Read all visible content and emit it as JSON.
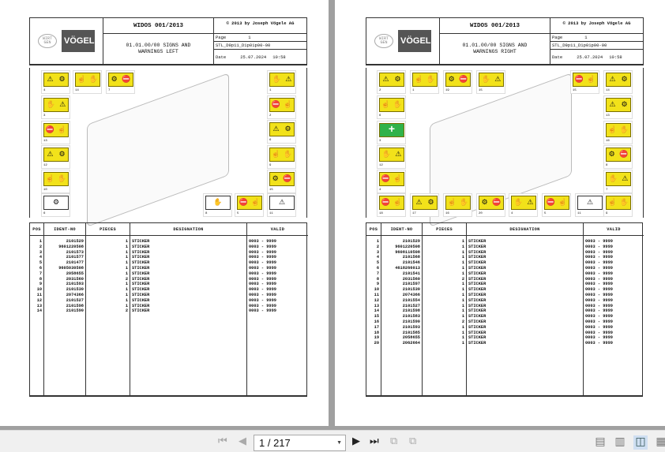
{
  "pages": [
    {
      "doc": "WIDOS 001/2013",
      "copyright": "© 2013 by Joseph Vögele AG",
      "subtitle": "01.01.00/00 SIGNS AND\nWARNINGS LEFT",
      "page_label": "Page",
      "page_num": "1",
      "code": "STL_D9p11_D1p01p00-00",
      "date_label": "Date",
      "date": "25.07.2024",
      "time": "10:58",
      "logo_wirtgen": "WIRTGEN GROUP",
      "logo_vogele": "VÖGELE",
      "stickers": [
        "4",
        "14",
        "7",
        "3",
        "13",
        "12",
        "10",
        "6",
        "1",
        "2",
        "6",
        "9",
        "15",
        "8",
        "5",
        "11"
      ],
      "headers": [
        "POS",
        "IDENT-NO",
        "PIECES",
        "DESIGNATION",
        "VALID"
      ],
      "rows": [
        [
          "1",
          "2101529",
          "1",
          "STICKER",
          "0003 - 9999"
        ],
        [
          "2",
          "9601220508",
          "1",
          "STICKER",
          "0003 - 9999"
        ],
        [
          "3",
          "2101573",
          "1",
          "STICKER",
          "0003 - 9999"
        ],
        [
          "4",
          "2101577",
          "1",
          "STICKER",
          "0003 - 9999"
        ],
        [
          "5",
          "2101477",
          "1",
          "STICKER",
          "0003 - 9999"
        ],
        [
          "6",
          "9605030508",
          "1",
          "STICKER",
          "0003 - 9999"
        ],
        [
          "7",
          "2058655",
          "1",
          "STICKER",
          "0003 - 9999"
        ],
        [
          "8",
          "2031560",
          "2",
          "STICKER",
          "0003 - 9999"
        ],
        [
          "9",
          "2101593",
          "1",
          "STICKER",
          "0003 - 9999"
        ],
        [
          "10",
          "2101530",
          "1",
          "STICKER",
          "0003 - 9999"
        ],
        [
          "11",
          "2074366",
          "1",
          "STICKER",
          "0003 - 9999"
        ],
        [
          "12",
          "2101527",
          "1",
          "STICKER",
          "0003 - 9999"
        ],
        [
          "13",
          "2101598",
          "1",
          "STICKER",
          "0003 - 9999"
        ],
        [
          "14",
          "2101590",
          "2",
          "STICKER",
          "0003 - 9999"
        ]
      ]
    },
    {
      "doc": "WIDOS 001/2013",
      "copyright": "© 2013 by Joseph Vögele AG",
      "subtitle": "01.01.00/00 SIGNS AND\nWARNINGS RIGHT",
      "page_label": "Page",
      "page_num": "1",
      "code": "STL_D9p11_D1p01p00-00",
      "date_label": "Date",
      "date": "25.07.2024",
      "time": "10:58",
      "logo_wirtgen": "WIRTGEN GROUP",
      "logo_vogele": "VÖGELE",
      "stickers": [
        "2",
        "1",
        "19",
        "15",
        "15",
        "14",
        "6",
        "3",
        "12",
        "4",
        "13",
        "16",
        "8",
        "7",
        "18",
        "17",
        "16",
        "20",
        "4",
        "5",
        "11",
        "9"
      ],
      "headers": [
        "POS",
        "IDENT-NO",
        "PIECES",
        "DESIGNATION",
        "VALID"
      ],
      "rows": [
        [
          "1",
          "2101529",
          "1",
          "STICKER",
          "0003 - 9999"
        ],
        [
          "2",
          "9601220508",
          "1",
          "STICKER",
          "0003 - 9999"
        ],
        [
          "3",
          "9608110508",
          "1",
          "STICKER",
          "0003 - 9999"
        ],
        [
          "4",
          "2101568",
          "1",
          "STICKER",
          "0003 - 9999"
        ],
        [
          "5",
          "2101546",
          "1",
          "STICKER",
          "0003 - 9999"
        ],
        [
          "6",
          "4618266013",
          "1",
          "STICKER",
          "0003 - 9999"
        ],
        [
          "7",
          "2101541",
          "1",
          "STICKER",
          "0003 - 9999"
        ],
        [
          "8",
          "2031560",
          "2",
          "STICKER",
          "0003 - 9999"
        ],
        [
          "9",
          "2101597",
          "1",
          "STICKER",
          "0003 - 9999"
        ],
        [
          "10",
          "2101530",
          "1",
          "STICKER",
          "0003 - 9999"
        ],
        [
          "11",
          "2074366",
          "1",
          "STICKER",
          "0003 - 9999"
        ],
        [
          "12",
          "2101554",
          "1",
          "STICKER",
          "0003 - 9999"
        ],
        [
          "13",
          "2101527",
          "1",
          "STICKER",
          "0003 - 9999"
        ],
        [
          "14",
          "2101598",
          "1",
          "STICKER",
          "0003 - 9999"
        ],
        [
          "15",
          "2101583",
          "1",
          "STICKER",
          "0003 - 9999"
        ],
        [
          "16",
          "2101590",
          "2",
          "STICKER",
          "0003 - 9999"
        ],
        [
          "17",
          "2101593",
          "1",
          "STICKER",
          "0003 - 9999"
        ],
        [
          "18",
          "2101585",
          "1",
          "STICKER",
          "0003 - 9999"
        ],
        [
          "19",
          "2058655",
          "1",
          "STICKER",
          "0003 - 9999"
        ],
        [
          "20",
          "2062664",
          "1",
          "STICKER",
          "0003 - 9999"
        ]
      ]
    }
  ],
  "toolbar": {
    "page_value": "1 / 217",
    "icons": [
      "first-page-icon",
      "prev-page-icon",
      "next-page-icon",
      "last-page-icon",
      "prev-view-icon",
      "next-view-icon",
      "single-page-icon",
      "continuous-icon",
      "facing-icon",
      "continuous-facing-icon"
    ]
  }
}
